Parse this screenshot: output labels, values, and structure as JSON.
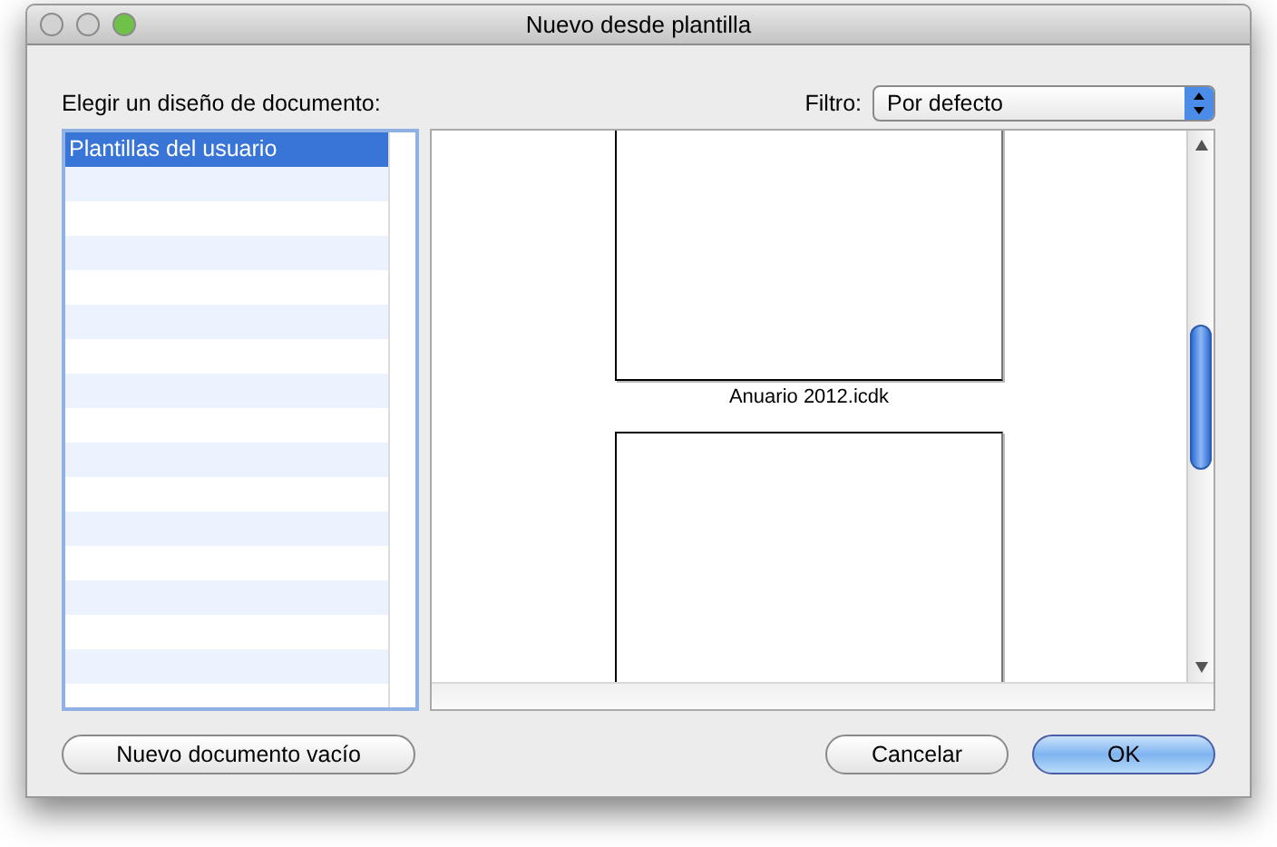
{
  "window": {
    "title": "Nuevo desde plantilla"
  },
  "category_label": "Elegir un diseño de documento:",
  "filter": {
    "label": "Filtro:",
    "value": "Por defecto"
  },
  "categories": [
    {
      "label": "Plantillas del usuario",
      "selected": true
    }
  ],
  "templates": [
    {
      "kind": "captioned",
      "name": "Anuario 2012.icdk"
    },
    {
      "kind": "plain"
    }
  ],
  "buttons": {
    "left": "Nuevo documento vacío",
    "cancel": "Cancelar",
    "ok": "OK"
  }
}
